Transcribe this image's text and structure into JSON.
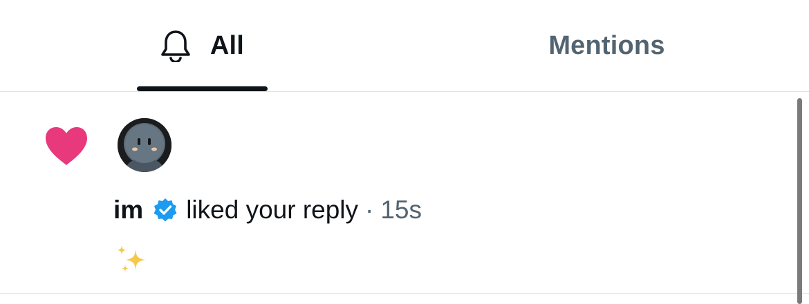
{
  "tabs": [
    {
      "label": "All",
      "icon": "bell-icon",
      "active": true
    },
    {
      "label": "Mentions",
      "active": false
    }
  ],
  "notification": {
    "type_icon": "heart-icon",
    "user": "im",
    "verified": true,
    "action": "liked your reply",
    "separator": "·",
    "time": "15s",
    "content_emoji": "sparkles"
  },
  "colors": {
    "active_text": "#0f1419",
    "inactive_text": "#536471",
    "heart": "#e8397d",
    "verified": "#1d9bf0",
    "sparkles": "#f7c948",
    "divider": "#e2e2e2"
  }
}
